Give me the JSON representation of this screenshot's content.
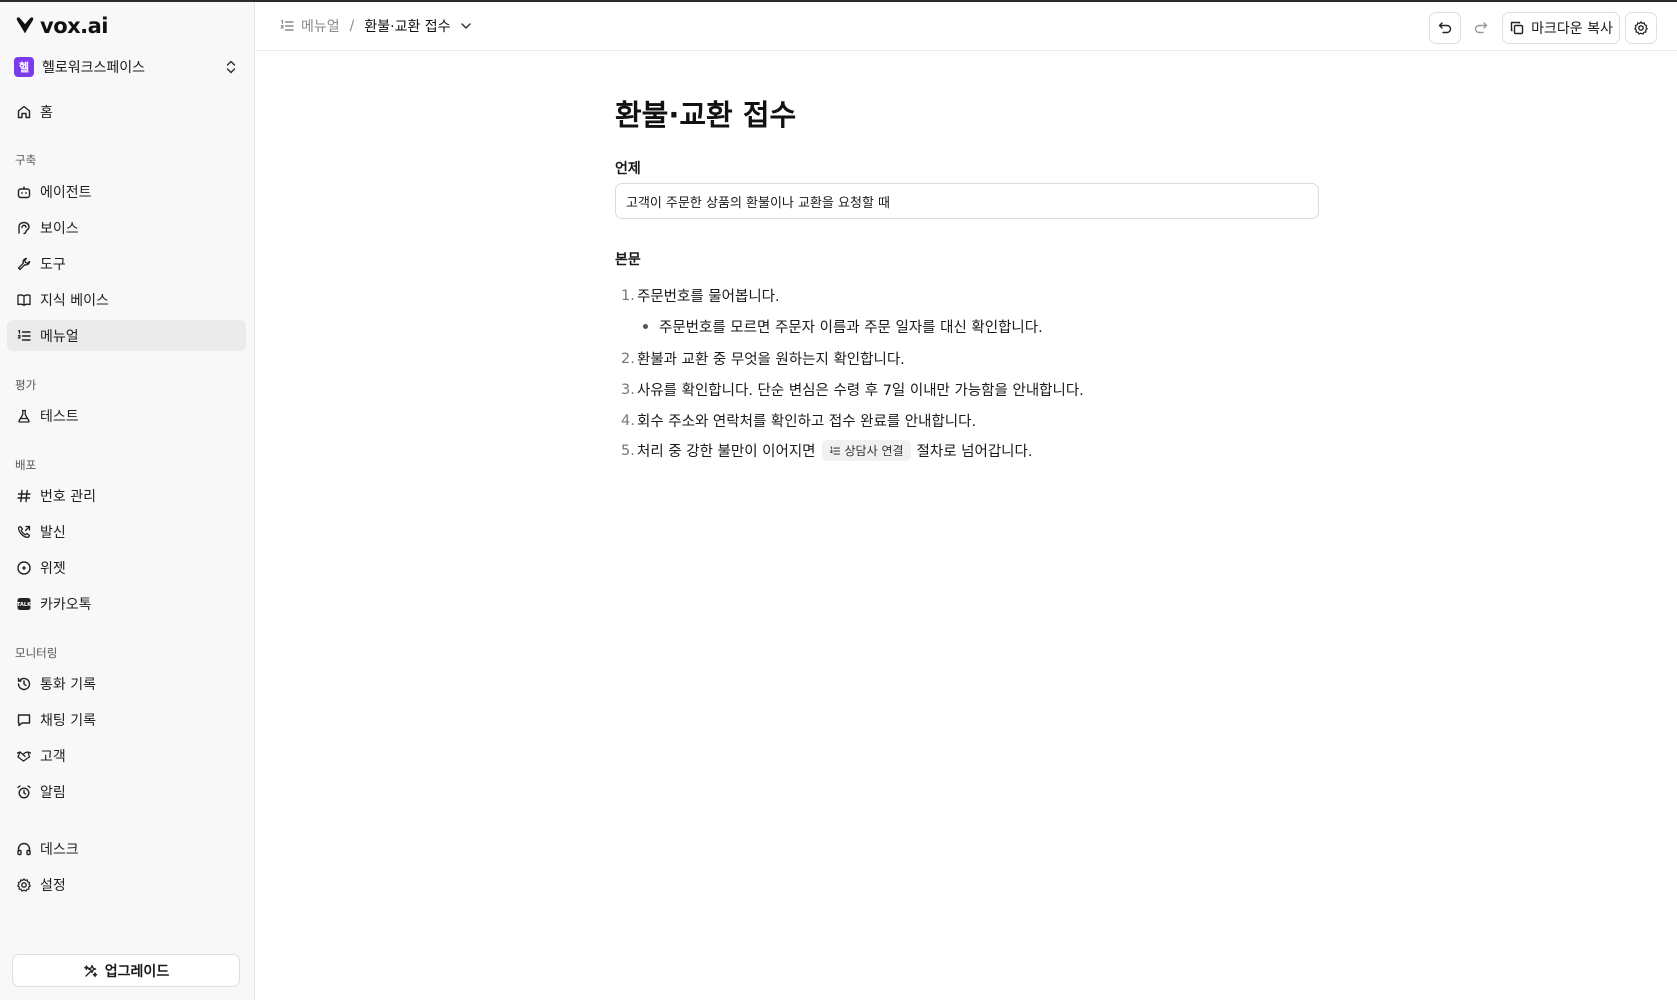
{
  "app": {
    "brand": "vox.ai",
    "accent_color": "#7c3aed"
  },
  "workspace": {
    "avatar_letter": "헬",
    "name": "헬로워크스페이스"
  },
  "sidebar": {
    "home": "홈",
    "sections": {
      "build": "구축",
      "evaluate": "평가",
      "deploy": "배포",
      "monitoring": "모니터링"
    },
    "items": {
      "agent": "에이전트",
      "voice": "보이스",
      "tools": "도구",
      "knowledge_base": "지식 베이스",
      "manual": "메뉴얼",
      "test": "테스트",
      "numbers": "번호 관리",
      "outbound": "발신",
      "widget": "위젯",
      "kakaotalk": "카카오톡",
      "call_logs": "통화 기록",
      "chat_logs": "채팅 기록",
      "customers": "고객",
      "alerts": "알림",
      "desk": "데스크",
      "settings": "설정"
    },
    "upgrade": "업그레이드",
    "active_item": "manual"
  },
  "header": {
    "breadcrumb_parent": "메뉴얼",
    "breadcrumb_sep": "/",
    "breadcrumb_current": "환불·교환 접수",
    "copy_markdown": "마크다운 복사"
  },
  "doc": {
    "title": "환불·교환 접수",
    "subject_label": "언제",
    "subject_value": "고객이 주문한 상품의 환불이나 교환을 요청할 때",
    "body_label": "본문",
    "steps": [
      {
        "num": "1.",
        "text": "주문번호를 물어봅니다."
      },
      {
        "sub": "주문번호를 모르면 주문자 이름과 주문 일자를 대신 확인합니다."
      },
      {
        "num": "2.",
        "text": "환불과 교환 중 무엇을 원하는지 확인합니다."
      },
      {
        "num": "3.",
        "text": "사유를 확인합니다. 단순 변심은 수령 후 7일 이내만 가능함을 안내합니다."
      },
      {
        "num": "4.",
        "text": "회수 주소와 연락처를 확인하고 접수 완료를 안내합니다."
      },
      {
        "num": "5.",
        "text_before": "처리 중 강한 불만이 이어지면",
        "chip": "상담사 연결",
        "text_after": "절차로 넘어갑니다."
      }
    ]
  }
}
